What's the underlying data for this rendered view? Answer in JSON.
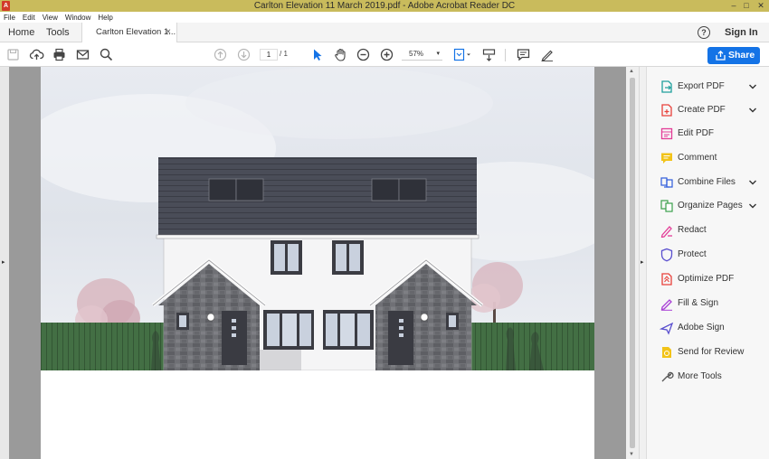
{
  "window": {
    "title": "Carlton Elevation 11 March 2019.pdf - Adobe Acrobat Reader DC",
    "controls": {
      "minimize": "–",
      "maximize": "□",
      "close": "✕"
    }
  },
  "menu": [
    "File",
    "Edit",
    "View",
    "Window",
    "Help"
  ],
  "tabs": {
    "home": "Home",
    "tools": "Tools",
    "document": "Carlton Elevation 1...",
    "close_glyph": "×"
  },
  "header": {
    "help": "?",
    "sign_in": "Sign In"
  },
  "toolbar": {
    "page_current": "1",
    "page_total": "/ 1",
    "zoom": "57%",
    "zoom_caret": "▾",
    "share_label": "Share",
    "icons": [
      "save-icon",
      "upload-icon",
      "print-icon",
      "email-icon",
      "search-icon",
      "prev-page-icon",
      "next-page-icon",
      "select-icon",
      "hand-icon",
      "zoom-out-icon",
      "zoom-in-icon",
      "fit-page-icon",
      "scroll-mode-icon",
      "comment-icon",
      "sign-icon"
    ]
  },
  "nav": {
    "left_arrow": "▸",
    "right_arrow": "▸",
    "scroll_up": "▲",
    "scroll_down": "▼"
  },
  "tools_pane": {
    "items": [
      {
        "label": "Export PDF",
        "icon": "export-pdf-icon",
        "color": "#1f9f9c",
        "expandable": true
      },
      {
        "label": "Create PDF",
        "icon": "create-pdf-icon",
        "color": "#e8413b",
        "expandable": true
      },
      {
        "label": "Edit PDF",
        "icon": "edit-pdf-icon",
        "color": "#e33e98",
        "expandable": false
      },
      {
        "label": "Comment",
        "icon": "comment-tool-icon",
        "color": "#f2c318",
        "expandable": false
      },
      {
        "label": "Combine Files",
        "icon": "combine-files-icon",
        "color": "#2d5bdc",
        "expandable": true
      },
      {
        "label": "Organize Pages",
        "icon": "organize-pages-icon",
        "color": "#3ba04c",
        "expandable": true
      },
      {
        "label": "Redact",
        "icon": "redact-icon",
        "color": "#e33e98",
        "expandable": false
      },
      {
        "label": "Protect",
        "icon": "protect-icon",
        "color": "#5a4fcf",
        "expandable": false
      },
      {
        "label": "Optimize PDF",
        "icon": "optimize-pdf-icon",
        "color": "#e8413b",
        "expandable": false
      },
      {
        "label": "Fill & Sign",
        "icon": "fill-sign-icon",
        "color": "#a83fd6",
        "expandable": false
      },
      {
        "label": "Adobe Sign",
        "icon": "adobe-sign-icon",
        "color": "#5a4fcf",
        "expandable": false
      },
      {
        "label": "Send for Review",
        "icon": "send-review-icon",
        "color": "#f2c318",
        "expandable": false
      },
      {
        "label": "More Tools",
        "icon": "more-tools-icon",
        "color": "#555555",
        "expandable": false
      }
    ]
  },
  "colors": {
    "title_bar": "#c9bb5c",
    "share_button": "#1473e6",
    "roof": "#4a4d58",
    "render_walls": "#f4f4f5",
    "stone": "#6d6e73",
    "fence": "#3d6b3f"
  }
}
